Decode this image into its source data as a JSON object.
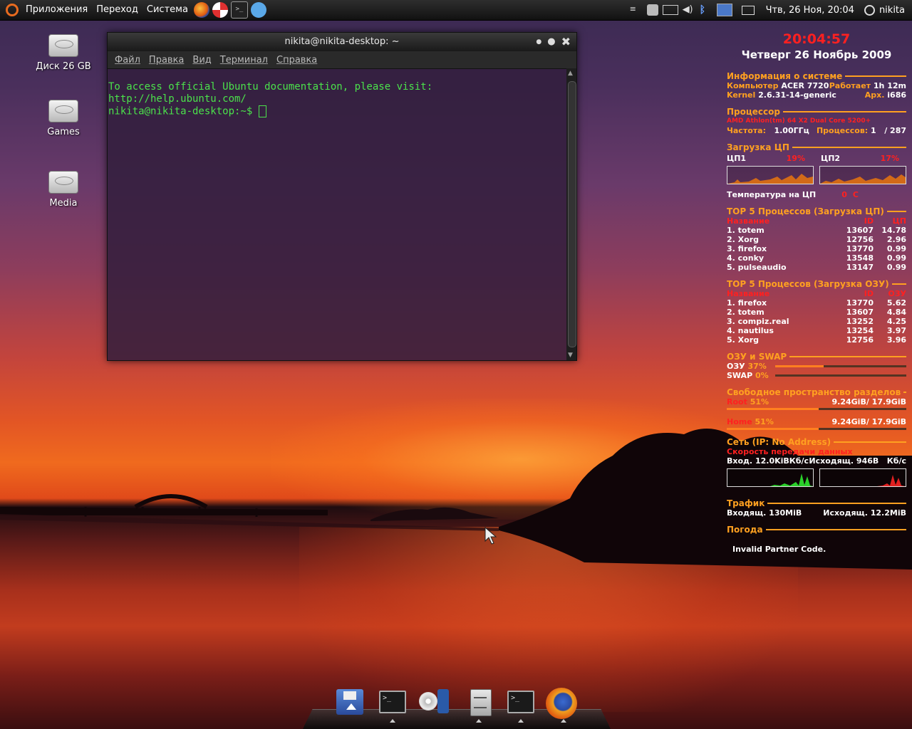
{
  "top_panel": {
    "menus": [
      "Приложения",
      "Переход",
      "Система"
    ],
    "launchers": [
      "firefox-icon",
      "help-icon",
      "terminal-icon",
      "pidgin-icon"
    ],
    "datetime": "Чтв, 26 Ноя, 20:04",
    "user": "nikita"
  },
  "desktop_icons": [
    {
      "label": "Диск 26 GB",
      "icon": "drive-icon"
    },
    {
      "label": "Games",
      "icon": "drive-icon"
    },
    {
      "label": "Media",
      "icon": "drive-icon"
    }
  ],
  "terminal": {
    "title": "nikita@nikita-desktop: ~",
    "menu": [
      "Файл",
      "Правка",
      "Вид",
      "Терминал",
      "Справка"
    ],
    "lines": [
      "To access official Ubuntu documentation, please visit:",
      "http://help.ubuntu.com/"
    ],
    "prompt": "nikita@nikita-desktop:~$ "
  },
  "conky": {
    "clock": "20:04:57",
    "date": "Четверг 26 Ноябрь 2009",
    "sysinfo": {
      "header": "Информация о системе",
      "computer_label": "Компьютер",
      "computer": "ACER 7720",
      "uptime_label": "Работает",
      "uptime": "1h 12m",
      "kernel_label": "Kernel",
      "kernel": "2.6.31-14-generic",
      "arch_label": "Арх.",
      "arch": "i686"
    },
    "cpu": {
      "header": "Процессор",
      "model": "AMD Athlon(tm) 64 X2 Dual Core 5200+",
      "freq_label": "Частота:",
      "freq": "1.00ГГц",
      "proc_label": "Процессов:",
      "proc": "1",
      "proc_total": "/ 287"
    },
    "cpu_load": {
      "header": "Загрузка ЦП",
      "cpu1_label": "ЦП1",
      "cpu1": "19%",
      "cpu2_label": "ЦП2",
      "cpu2": "17%",
      "temp_label": "Температура на ЦП",
      "temp": "0",
      "temp_unit": "C"
    },
    "top_cpu": {
      "header": "TOP 5 Процессов (Загрузка ЦП)",
      "cols": [
        "Название",
        "ID",
        "ЦП"
      ],
      "rows": [
        [
          "1. totem",
          "13607",
          "14.78"
        ],
        [
          "2. Xorg",
          "12756",
          "2.96"
        ],
        [
          "3. firefox",
          "13770",
          "0.99"
        ],
        [
          "4. conky",
          "13548",
          "0.99"
        ],
        [
          "5. pulseaudio",
          "13147",
          "0.99"
        ]
      ]
    },
    "top_mem": {
      "header": "TOP 5 Процессов (Загрузка ОЗУ)",
      "cols": [
        "Название",
        "ID",
        "ОЗУ"
      ],
      "rows": [
        [
          "1. firefox",
          "13770",
          "5.62"
        ],
        [
          "2. totem",
          "13607",
          "4.84"
        ],
        [
          "3. compiz.real",
          "13252",
          "4.25"
        ],
        [
          "4. nautilus",
          "13254",
          "3.97"
        ],
        [
          "5. Xorg",
          "12756",
          "3.96"
        ]
      ]
    },
    "mem": {
      "header": "ОЗУ и SWAP",
      "ram_label": "ОЗУ",
      "ram": "37%",
      "ram_fraction": 0.37,
      "swap_label": "SWAP",
      "swap": "0%",
      "swap_fraction": 0.0
    },
    "disk": {
      "header": "Свободное пространство разделов",
      "root_label": "Root",
      "root_pct": "51%",
      "root_usage": "9.24GiB/ 17.9GiB",
      "root_fraction": 0.51,
      "home_label": "Home",
      "home_pct": "51%",
      "home_usage": "9.24GiB/ 17.9GiB",
      "home_fraction": 0.51
    },
    "net": {
      "header": "Сеть (IP: No Address)",
      "speed_label": "Скорость передачи данных",
      "down_label": "Вход.",
      "down": "12.0KiB",
      "down_unit": "Кб/с",
      "up_label": "Исходящ.",
      "up": "946B",
      "up_unit": "Кб/с"
    },
    "traffic": {
      "header": "Трафик",
      "in_label": "Входящ.",
      "in": "130MiB",
      "out_label": "Исходящ.",
      "out": "12.2MiB"
    },
    "weather": {
      "header": "Погода",
      "text": "Invalid Partner Code."
    }
  },
  "dock": [
    "floppy-save-icon",
    "terminal-icon",
    "media-player-icon",
    "file-cabinet-icon",
    "terminal-icon",
    "firefox-icon"
  ],
  "colors": {
    "accent_orange": "#ffa020",
    "accent_red": "#ff2020",
    "terminal_green": "#4be24b"
  }
}
